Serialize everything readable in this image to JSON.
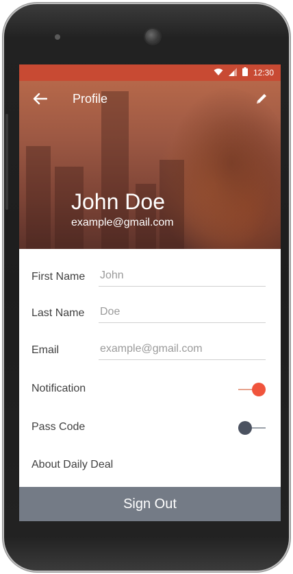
{
  "status_bar": {
    "time": "12:30"
  },
  "header": {
    "title": "Profile",
    "name": "John Doe",
    "email": "example@gmail.com"
  },
  "form": {
    "first_name": {
      "label": "First Name",
      "placeholder": "John"
    },
    "last_name": {
      "label": "Last Name",
      "placeholder": "Doe"
    },
    "email": {
      "label": "Email",
      "placeholder": "example@gmail.com"
    },
    "notification": {
      "label": "Notification",
      "state": "on"
    },
    "pass_code": {
      "label": "Pass Code",
      "state": "off"
    },
    "about": {
      "label": "About Daily Deal"
    }
  },
  "footer": {
    "sign_out_label": "Sign Out"
  },
  "colors": {
    "accent": "#f0543c",
    "status_bar": "#c84a33",
    "sign_out_bg": "#747b86"
  },
  "icons": {
    "back": "arrow-left-icon",
    "edit": "pencil-icon",
    "wifi": "wifi-icon",
    "signal": "signal-icon",
    "battery": "battery-icon"
  }
}
